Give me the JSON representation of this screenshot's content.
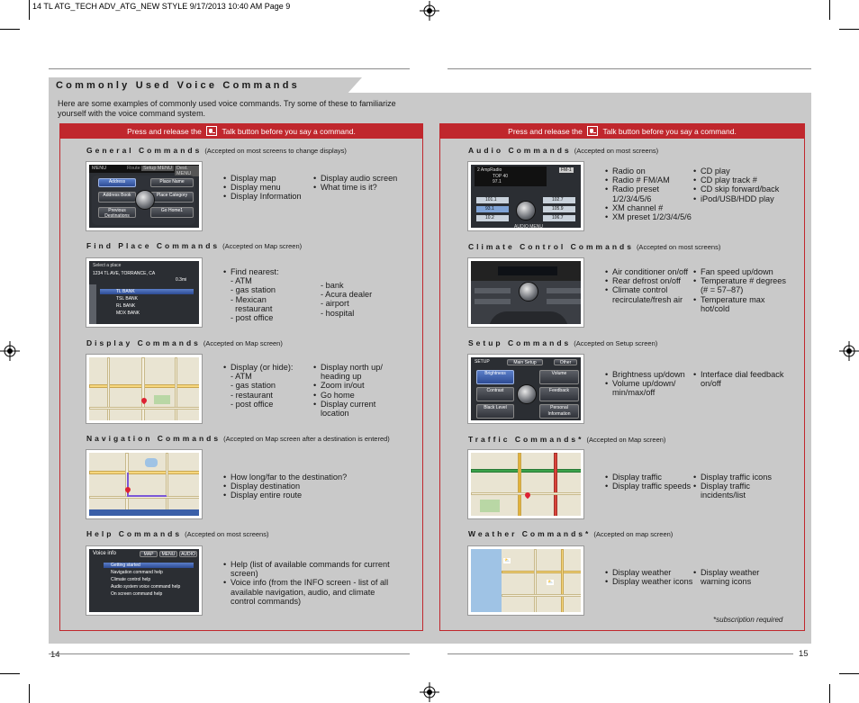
{
  "print_header": "14 TL ATG_TECH ADV_ATG_NEW STYLE  9/17/2013  10:40 AM  Page 9",
  "title": "Commonly Used Voice Commands",
  "intro": "Here are some examples of commonly used voice commands. Try some of these to familiarize yourself with the voice command system.",
  "panel_header": {
    "before": "Press and release the",
    "after": "Talk button before you say a command."
  },
  "left": {
    "general": {
      "title": "General Commands",
      "note": "(Accepted on most screens to change displays)",
      "col1": [
        "Display map",
        "Display menu",
        "Display Information"
      ],
      "col2": [
        "Display audio screen",
        "What time is it?"
      ],
      "screen": {
        "menu": "MENU",
        "tabs": [
          "Route",
          "Setup MENU",
          "Dest. MENU"
        ],
        "btn1": "Address",
        "btn2": "Place Name",
        "btn3": "Address Book",
        "btn4": "Place Category",
        "btn5": "Previous Destinations",
        "btn6": "Go Home1"
      }
    },
    "find": {
      "title": "Find Place Commands",
      "note": "(Accepted on Map screen)",
      "col1_head": "Find nearest:",
      "col1": [
        "- ATM",
        "- gas station",
        "- Mexican",
        "  restaurant",
        "- post office"
      ],
      "col2": [
        "- bank",
        "- Acura dealer",
        "- airport",
        "- hospital"
      ],
      "screen": {
        "header": "Select a place",
        "addr": "1234 TL AVE, TORRANCE, CA",
        "dist": "0.3mi",
        "rows": [
          "TL BANK",
          "TSL BANK",
          "RL BANK",
          "MDX BANK"
        ]
      }
    },
    "display": {
      "title": "Display Commands",
      "note": "(Accepted on Map screen)",
      "col1_head": "Display (or hide):",
      "col1": [
        "- ATM",
        "- gas station",
        "- restaurant",
        "- post office"
      ],
      "col2": [
        "Display north up/ heading up",
        "Zoom in/out",
        "Go home",
        "Display current location"
      ]
    },
    "navigation": {
      "title": "Navigation Commands",
      "note": "(Accepted on Map screen after a destination is entered)",
      "col1": [
        "How long/far to the destination?",
        "Display destination",
        "Display entire route"
      ]
    },
    "help": {
      "title": "Help Commands",
      "note": "(Accepted on most screens)",
      "col1": [
        "Help (list of available commands for current screen)",
        "Voice info (from the INFO screen - list of all available navigation, audio, and climate control commands)"
      ],
      "screen": {
        "header": "Voice info",
        "tabs": [
          "MAP",
          "MENU",
          "AUDIO"
        ],
        "rows": [
          "Getting started",
          "Navigation command help",
          "Climate control help",
          "Audio system voice command help",
          "On screen command help"
        ]
      }
    }
  },
  "right": {
    "audio": {
      "title": "Audio Commands",
      "note": "(Accepted on most screens)",
      "col1": [
        "Radio on",
        "Radio # FM/AM",
        "Radio preset 1/2/3/4/5/6",
        "XM channel #",
        "XM preset 1/2/3/4/5/6"
      ],
      "col2": [
        "CD play",
        "CD play track #",
        "CD skip forward/back",
        "iPod/USB/HDD play"
      ],
      "screen": {
        "line1": "2  AmpRadio",
        "line2": "TOP 40",
        "line3": "97.1",
        "badge": "FM-1",
        "presets_left": [
          "101.1",
          "93.1",
          "10.2"
        ],
        "presets_right": [
          "102.7",
          "105.9",
          "106.7"
        ],
        "foot": "AUDIO MENU"
      }
    },
    "climate": {
      "title": "Climate Control Commands",
      "note": "(Accepted on most screens)",
      "col1": [
        "Air conditioner on/off",
        "Rear defrost on/off",
        "Climate control recirculate/fresh air"
      ],
      "col2": [
        "Fan speed up/down",
        "Temperature # degrees (# = 57–87)",
        "Temperature max hot/cold"
      ]
    },
    "setup": {
      "title": "Setup Commands",
      "note": "(Accepted on Setup screen)",
      "col1": [
        "Brightness up/down",
        "Volume up/down/ min/max/off"
      ],
      "col2": [
        "Interface dial feedback on/off"
      ],
      "screen": {
        "header": "SETUP",
        "tabs": [
          "Main Setup",
          "Other"
        ],
        "btn1": "Brightness",
        "btn2": "Volume",
        "btn3": "Contrast",
        "btn4": "Feedback",
        "btn5": "Black Level",
        "btn6": "Personal Information"
      }
    },
    "traffic": {
      "title": "Traffic Commands*",
      "note": "(Accepted on Map screen)",
      "col1": [
        "Display traffic",
        "Display traffic speeds"
      ],
      "col2": [
        "Display traffic icons",
        "Display traffic incidents/list"
      ]
    },
    "weather": {
      "title": "Weather Commands*",
      "note": "(Accepted on map screen)",
      "col1": [
        "Display weather",
        "Display weather icons"
      ],
      "col2": [
        "Display weather warning icons"
      ]
    }
  },
  "footnote": "*subscription required",
  "page_left": "14",
  "page_right": "15"
}
